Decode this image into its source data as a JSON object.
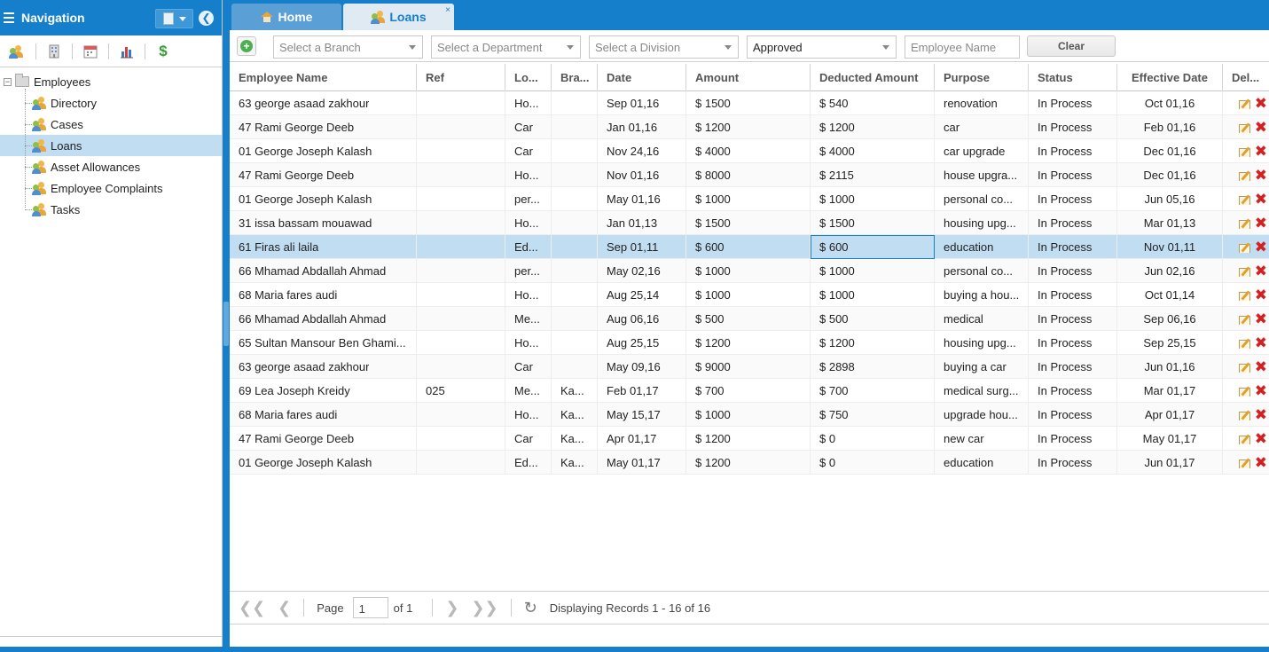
{
  "nav": {
    "title": "Navigation",
    "tree": {
      "root_label": "Employees",
      "children": [
        "Directory",
        "Cases",
        "Loans",
        "Asset Allowances",
        "Employee Complaints",
        "Tasks"
      ]
    }
  },
  "tabs": {
    "home": "Home",
    "loans": "Loans",
    "close_glyph": "×"
  },
  "filters": {
    "branch_placeholder": "Select a Branch",
    "department_placeholder": "Select a Department",
    "division_placeholder": "Select a Division",
    "status_value": "Approved",
    "name_placeholder": "Employee Name",
    "clear_label": "Clear"
  },
  "grid": {
    "columns": [
      "Employee Name",
      "Ref",
      "Lo...",
      "Bra...",
      "Date",
      "Amount",
      "Deducted Amount",
      "Purpose",
      "Status",
      "Effective Date",
      "Del..."
    ],
    "rows": [
      [
        "63 george asaad zakhour",
        "",
        "Ho...",
        "",
        "Sep 01,16",
        "$ 1500",
        "$ 540",
        "renovation",
        "In Process",
        "Oct 01,16"
      ],
      [
        "47 Rami George Deeb",
        "",
        "Car",
        "",
        "Jan 01,16",
        "$ 1200",
        "$ 1200",
        "car",
        "In Process",
        "Feb 01,16"
      ],
      [
        "01 George Joseph Kalash",
        "",
        "Car",
        "",
        "Nov 24,16",
        "$ 4000",
        "$ 4000",
        "car upgrade",
        "In Process",
        "Dec 01,16"
      ],
      [
        "47 Rami George Deeb",
        "",
        "Ho...",
        "",
        "Nov 01,16",
        "$ 8000",
        "$ 2115",
        "house upgra...",
        "In Process",
        "Dec 01,16"
      ],
      [
        "01 George Joseph Kalash",
        "",
        "per...",
        "",
        "May 01,16",
        "$ 1000",
        "$ 1000",
        "personal co...",
        "In Process",
        "Jun 05,16"
      ],
      [
        "31 issa bassam mouawad",
        "",
        "Ho...",
        "",
        "Jan 01,13",
        "$ 1500",
        "$ 1500",
        "housing upg...",
        "In Process",
        "Mar 01,13"
      ],
      [
        "61 Firas ali laila",
        "",
        "Ed...",
        "",
        "Sep 01,11",
        "$ 600",
        "$ 600",
        "education",
        "In Process",
        "Nov 01,11"
      ],
      [
        "66 Mhamad Abdallah Ahmad",
        "",
        "per...",
        "",
        "May 02,16",
        "$ 1000",
        "$ 1000",
        "personal co...",
        "In Process",
        "Jun 02,16"
      ],
      [
        "68 Maria fares audi",
        "",
        "Ho...",
        "",
        "Aug 25,14",
        "$ 1000",
        "$ 1000",
        "buying a hou...",
        "In Process",
        "Oct 01,14"
      ],
      [
        "66 Mhamad Abdallah Ahmad",
        "",
        "Me...",
        "",
        "Aug 06,16",
        "$ 500",
        "$ 500",
        "medical",
        "In Process",
        "Sep 06,16"
      ],
      [
        "65 Sultan Mansour Ben Ghami...",
        "",
        "Ho...",
        "",
        "Aug 25,15",
        "$ 1200",
        "$ 1200",
        "housing upg...",
        "In Process",
        "Sep 25,15"
      ],
      [
        "63 george asaad zakhour",
        "",
        "Car",
        "",
        "May 09,16",
        "$ 9000",
        "$ 2898",
        "buying a car",
        "In Process",
        "Jun 01,16"
      ],
      [
        "69 Lea Joseph Kreidy",
        "025",
        "Me...",
        "Ka...",
        "Feb 01,17",
        "$ 700",
        "$ 700",
        "medical surg...",
        "In Process",
        "Mar 01,17"
      ],
      [
        "68 Maria fares audi",
        "",
        "Ho...",
        "Ka...",
        "May 15,17",
        "$ 1000",
        "$ 750",
        "upgrade hou...",
        "In Process",
        "Apr 01,17"
      ],
      [
        "47 Rami George Deeb",
        "",
        "Car",
        "Ka...",
        "Apr 01,17",
        "$ 1200",
        "$ 0",
        "new car",
        "In Process",
        "May 01,17"
      ],
      [
        "01 George Joseph Kalash",
        "",
        "Ed...",
        "Ka...",
        "May 01,17",
        "$ 1200",
        "$ 0",
        "education",
        "In Process",
        "Jun 01,17"
      ]
    ],
    "selected_row_index": 6
  },
  "paging": {
    "page_label": "Page",
    "page_value": "1",
    "of_label": "of 1",
    "display_text": "Displaying Records 1 - 16 of 16"
  },
  "colors": {
    "accent": "#157fcc",
    "selected": "#c1ddf1",
    "delete": "#d32020",
    "add": "#4caf50"
  }
}
